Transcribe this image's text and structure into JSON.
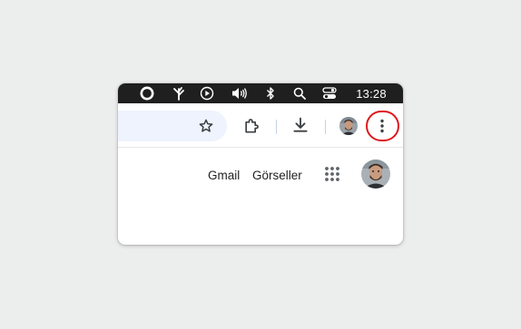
{
  "system_menubar": {
    "clock": "13:28",
    "icons": [
      "circle-record-icon",
      "tree-icon",
      "play-circle-icon",
      "volume-icon",
      "bluetooth-icon",
      "search-icon",
      "control-center-icon"
    ]
  },
  "toolbar": {
    "icons": [
      "star-icon",
      "extensions-puzzle-icon",
      "download-icon",
      "profile-avatar",
      "more-vertical-icon"
    ],
    "highlight_color": "#e0171d"
  },
  "header_links": {
    "gmail": "Gmail",
    "images": "Görseller"
  },
  "colors": {
    "menubar_bg": "#1f1f1f",
    "omnibox_bg": "#eef3fd",
    "page_bg": "#eceded"
  }
}
